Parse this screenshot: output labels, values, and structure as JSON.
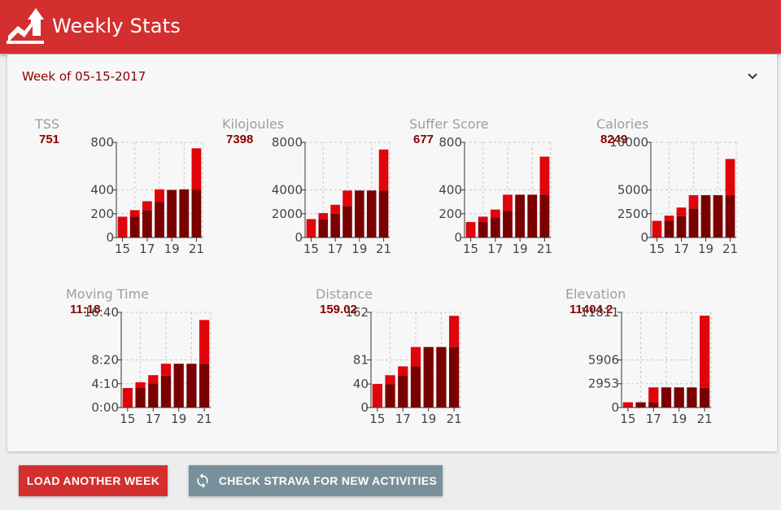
{
  "app": {
    "title": "Weekly Stats"
  },
  "week": {
    "header": "Week of 05-15-2017"
  },
  "colors": {
    "accent": "#d32f2f",
    "dark_bar": "#7a0000",
    "bright_bar": "#e0040b",
    "gray_button": "#78909c"
  },
  "icons": {
    "logo": "trend-arrow-icon",
    "expand": "chevron-down-icon",
    "sync": "sync-icon"
  },
  "buttons": {
    "load": "LOAD ANOTHER WEEK",
    "check": "CHECK STRAVA FOR NEW ACTIVITIES"
  },
  "chart_data": [
    {
      "type": "bar",
      "title": "TSS",
      "total": "751",
      "categories": [
        15,
        16,
        17,
        18,
        19,
        20,
        21
      ],
      "x_tick_labels": [
        "15",
        "17",
        "19",
        "21"
      ],
      "ylim": [
        0,
        800
      ],
      "y_ticks": [
        0,
        200,
        400,
        800
      ],
      "y_tick_labels": [
        "0",
        "200",
        "400",
        "800"
      ],
      "series": [
        {
          "values": [
            0,
            175,
            230,
            300,
            400,
            405,
            400
          ]
        },
        {
          "values": [
            175,
            55,
            75,
            105,
            0,
            0,
            350
          ]
        }
      ]
    },
    {
      "type": "bar",
      "title": "Kilojoules",
      "total": "7398",
      "categories": [
        15,
        16,
        17,
        18,
        19,
        20,
        21
      ],
      "x_tick_labels": [
        "15",
        "17",
        "19",
        "21"
      ],
      "ylim": [
        0,
        8000
      ],
      "y_ticks": [
        0,
        2000,
        4000,
        8000
      ],
      "y_tick_labels": [
        "0",
        "2000",
        "4000",
        "8000"
      ],
      "series": [
        {
          "values": [
            0,
            1550,
            2000,
            2650,
            3950,
            3950,
            3950
          ]
        },
        {
          "values": [
            1550,
            500,
            750,
            1300,
            0,
            0,
            3450
          ]
        }
      ]
    },
    {
      "type": "bar",
      "title": "Suffer Score",
      "total": "677",
      "categories": [
        15,
        16,
        17,
        18,
        19,
        20,
        21
      ],
      "x_tick_labels": [
        "15",
        "17",
        "19",
        "21"
      ],
      "ylim": [
        0,
        800
      ],
      "y_ticks": [
        0,
        200,
        400,
        800
      ],
      "y_tick_labels": [
        "0",
        "200",
        "400",
        "800"
      ],
      "series": [
        {
          "values": [
            0,
            130,
            170,
            225,
            360,
            360,
            360
          ]
        },
        {
          "values": [
            130,
            45,
            65,
            135,
            0,
            0,
            320
          ]
        }
      ]
    },
    {
      "type": "bar",
      "title": "Calories",
      "total": "8249",
      "categories": [
        15,
        16,
        17,
        18,
        19,
        20,
        21
      ],
      "x_tick_labels": [
        "15",
        "17",
        "19",
        "21"
      ],
      "ylim": [
        0,
        10000
      ],
      "y_ticks": [
        0,
        2500,
        5000,
        10000
      ],
      "y_tick_labels": [
        "0",
        "2500",
        "5000",
        "10000"
      ],
      "series": [
        {
          "values": [
            0,
            1750,
            2250,
            3050,
            4450,
            4450,
            4450
          ]
        },
        {
          "values": [
            1750,
            550,
            900,
            1400,
            0,
            0,
            3800
          ]
        }
      ]
    },
    {
      "type": "bar",
      "title": "Moving Time",
      "total": "11:18",
      "categories": [
        15,
        16,
        17,
        18,
        19,
        20,
        21
      ],
      "x_tick_labels": [
        "15",
        "17",
        "19",
        "21"
      ],
      "ylim": [
        0,
        1000
      ],
      "y_ticks": [
        0,
        250,
        500,
        1000
      ],
      "y_tick_labels": [
        "0:00",
        "4:10",
        "8:20",
        "16:40"
      ],
      "series": [
        {
          "values": [
            0,
            205,
            255,
            335,
            460,
            460,
            460
          ]
        },
        {
          "values": [
            205,
            60,
            85,
            125,
            0,
            0,
            460
          ]
        }
      ]
    },
    {
      "type": "bar",
      "title": "Distance",
      "total": "159.02",
      "categories": [
        15,
        16,
        17,
        18,
        19,
        20,
        21
      ],
      "x_tick_labels": [
        "15",
        "17",
        "19",
        "21"
      ],
      "ylim": [
        0,
        162
      ],
      "y_ticks": [
        0,
        40,
        81,
        162
      ],
      "y_tick_labels": [
        "0",
        "40",
        "81",
        "162"
      ],
      "series": [
        {
          "values": [
            0,
            40,
            55,
            70,
            103,
            103,
            103
          ]
        },
        {
          "values": [
            40,
            15,
            15,
            33,
            0,
            0,
            53
          ]
        }
      ]
    },
    {
      "type": "bar",
      "title": "Elevation",
      "total": "11404.2",
      "categories": [
        15,
        16,
        17,
        18,
        19,
        20,
        21
      ],
      "x_tick_labels": [
        "15",
        "17",
        "19",
        "21"
      ],
      "ylim": [
        0,
        11811
      ],
      "y_ticks": [
        0,
        2953,
        5906,
        11811
      ],
      "y_tick_labels": [
        "0",
        "2953",
        "5906",
        "11811"
      ],
      "series": [
        {
          "values": [
            0,
            650,
            650,
            2500,
            2500,
            2500,
            2450
          ]
        },
        {
          "values": [
            650,
            0,
            1850,
            0,
            0,
            0,
            8950
          ]
        }
      ]
    }
  ]
}
